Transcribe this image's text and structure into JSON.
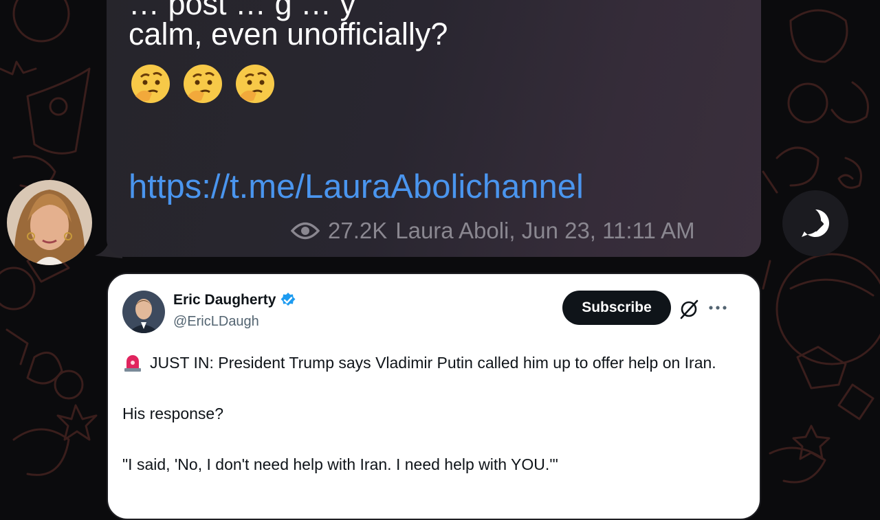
{
  "message": {
    "text_partial_top": "… post … g … y",
    "text_line": "calm, even unofficially?",
    "emojis": [
      "thinking-face",
      "thinking-face",
      "thinking-face"
    ],
    "link": "https://t.me/LauraAbolichannel",
    "views": "27.2K",
    "footer": "Laura Aboli, Jun 23, 11:11 AM"
  },
  "tweet": {
    "author_name": "Eric Daugherty",
    "author_handle": "@EricLDaugh",
    "subscribe_label": "Subscribe",
    "body_line1": "JUST IN: President Trump says Vladimir Putin called him up to offer help on Iran.",
    "body_line2": "His response?",
    "body_line3": "\"I said, 'No, I don't need help with Iran. I need help with YOU.'\""
  },
  "colors": {
    "link": "#4a95ee",
    "verified": "#1d9bf0",
    "subscribe_bg": "#0f1419"
  },
  "icons": {
    "views": "eye-icon",
    "share": "forward-arrow-icon",
    "verified": "verified-badge-icon",
    "siren": "rotating-light-icon",
    "grok": "grok-icon",
    "more": "more-dots-icon"
  }
}
